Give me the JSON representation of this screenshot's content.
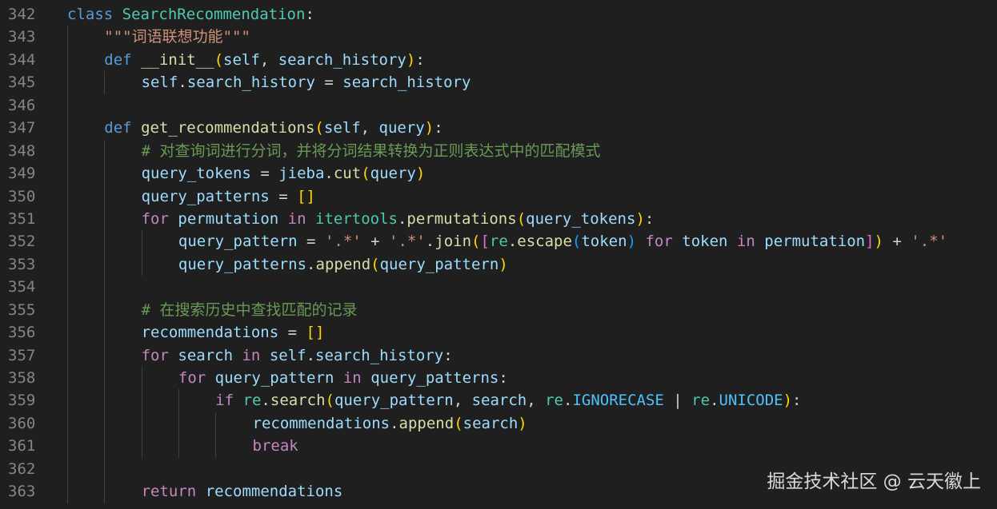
{
  "editor": {
    "lines": [
      {
        "n": "342",
        "indent": 0,
        "tokens": [
          [
            "kw",
            "class"
          ],
          [
            "op",
            " "
          ],
          [
            "cls",
            "SearchRecommendation"
          ],
          [
            "op",
            ":"
          ]
        ]
      },
      {
        "n": "343",
        "indent": 1,
        "tokens": [
          [
            "str",
            "\"\"\"词语联想功能\"\"\""
          ]
        ]
      },
      {
        "n": "344",
        "indent": 1,
        "tokens": [
          [
            "kw",
            "def"
          ],
          [
            "op",
            " "
          ],
          [
            "fn",
            "__init__"
          ],
          [
            "b1",
            "("
          ],
          [
            "var",
            "self"
          ],
          [
            "op",
            ", "
          ],
          [
            "var",
            "search_history"
          ],
          [
            "b1",
            ")"
          ],
          [
            "op",
            ":"
          ]
        ]
      },
      {
        "n": "345",
        "indent": 2,
        "tokens": [
          [
            "var",
            "self"
          ],
          [
            "op",
            "."
          ],
          [
            "var",
            "search_history"
          ],
          [
            "op",
            " = "
          ],
          [
            "var",
            "search_history"
          ]
        ]
      },
      {
        "n": "346",
        "indent": 0,
        "tokens": []
      },
      {
        "n": "347",
        "indent": 1,
        "tokens": [
          [
            "kw",
            "def"
          ],
          [
            "op",
            " "
          ],
          [
            "fn",
            "get_recommendations"
          ],
          [
            "b1",
            "("
          ],
          [
            "var",
            "self"
          ],
          [
            "op",
            ", "
          ],
          [
            "var",
            "query"
          ],
          [
            "b1",
            ")"
          ],
          [
            "op",
            ":"
          ]
        ]
      },
      {
        "n": "348",
        "indent": 2,
        "tokens": [
          [
            "com",
            "# 对查询词进行分词，并将分词结果转换为正则表达式中的匹配模式"
          ]
        ]
      },
      {
        "n": "349",
        "indent": 2,
        "tokens": [
          [
            "var",
            "query_tokens"
          ],
          [
            "op",
            " = "
          ],
          [
            "var",
            "jieba"
          ],
          [
            "op",
            "."
          ],
          [
            "fn",
            "cut"
          ],
          [
            "b1",
            "("
          ],
          [
            "var",
            "query"
          ],
          [
            "b1",
            ")"
          ]
        ]
      },
      {
        "n": "350",
        "indent": 2,
        "tokens": [
          [
            "var",
            "query_patterns"
          ],
          [
            "op",
            " = "
          ],
          [
            "b1",
            "[]"
          ]
        ]
      },
      {
        "n": "351",
        "indent": 2,
        "tokens": [
          [
            "ctl",
            "for"
          ],
          [
            "op",
            " "
          ],
          [
            "var",
            "permutation"
          ],
          [
            "op",
            " "
          ],
          [
            "ctl",
            "in"
          ],
          [
            "op",
            " "
          ],
          [
            "cls",
            "itertools"
          ],
          [
            "op",
            "."
          ],
          [
            "fn",
            "permutations"
          ],
          [
            "b1",
            "("
          ],
          [
            "var",
            "query_tokens"
          ],
          [
            "b1",
            ")"
          ],
          [
            "op",
            ":"
          ]
        ]
      },
      {
        "n": "352",
        "indent": 3,
        "tokens": [
          [
            "var",
            "query_pattern"
          ],
          [
            "op",
            " = "
          ],
          [
            "str",
            "'.*'"
          ],
          [
            "op",
            " + "
          ],
          [
            "str",
            "'.*'"
          ],
          [
            "op",
            "."
          ],
          [
            "fn",
            "join"
          ],
          [
            "b1",
            "("
          ],
          [
            "b2",
            "["
          ],
          [
            "cls",
            "re"
          ],
          [
            "op",
            "."
          ],
          [
            "fn",
            "escape"
          ],
          [
            "b3",
            "("
          ],
          [
            "var",
            "token"
          ],
          [
            "b3",
            ")"
          ],
          [
            "op",
            " "
          ],
          [
            "ctl",
            "for"
          ],
          [
            "op",
            " "
          ],
          [
            "var",
            "token"
          ],
          [
            "op",
            " "
          ],
          [
            "ctl",
            "in"
          ],
          [
            "op",
            " "
          ],
          [
            "var",
            "permutation"
          ],
          [
            "b2",
            "]"
          ],
          [
            "b1",
            ")"
          ],
          [
            "op",
            " + "
          ],
          [
            "str",
            "'.*'"
          ]
        ]
      },
      {
        "n": "353",
        "indent": 3,
        "tokens": [
          [
            "var",
            "query_patterns"
          ],
          [
            "op",
            "."
          ],
          [
            "fn",
            "append"
          ],
          [
            "b1",
            "("
          ],
          [
            "var",
            "query_pattern"
          ],
          [
            "b1",
            ")"
          ]
        ]
      },
      {
        "n": "354",
        "indent": 0,
        "tokens": []
      },
      {
        "n": "355",
        "indent": 2,
        "tokens": [
          [
            "com",
            "# 在搜索历史中查找匹配的记录"
          ]
        ]
      },
      {
        "n": "356",
        "indent": 2,
        "tokens": [
          [
            "var",
            "recommendations"
          ],
          [
            "op",
            " = "
          ],
          [
            "b1",
            "[]"
          ]
        ]
      },
      {
        "n": "357",
        "indent": 2,
        "tokens": [
          [
            "ctl",
            "for"
          ],
          [
            "op",
            " "
          ],
          [
            "var",
            "search"
          ],
          [
            "op",
            " "
          ],
          [
            "ctl",
            "in"
          ],
          [
            "op",
            " "
          ],
          [
            "var",
            "self"
          ],
          [
            "op",
            "."
          ],
          [
            "var",
            "search_history"
          ],
          [
            "op",
            ":"
          ]
        ]
      },
      {
        "n": "358",
        "indent": 3,
        "tokens": [
          [
            "ctl",
            "for"
          ],
          [
            "op",
            " "
          ],
          [
            "var",
            "query_pattern"
          ],
          [
            "op",
            " "
          ],
          [
            "ctl",
            "in"
          ],
          [
            "op",
            " "
          ],
          [
            "var",
            "query_patterns"
          ],
          [
            "op",
            ":"
          ]
        ]
      },
      {
        "n": "359",
        "indent": 4,
        "tokens": [
          [
            "ctl",
            "if"
          ],
          [
            "op",
            " "
          ],
          [
            "cls",
            "re"
          ],
          [
            "op",
            "."
          ],
          [
            "fn",
            "search"
          ],
          [
            "b1",
            "("
          ],
          [
            "var",
            "query_pattern"
          ],
          [
            "op",
            ", "
          ],
          [
            "var",
            "search"
          ],
          [
            "op",
            ", "
          ],
          [
            "cls",
            "re"
          ],
          [
            "op",
            "."
          ],
          [
            "cst",
            "IGNORECASE"
          ],
          [
            "op",
            " | "
          ],
          [
            "cls",
            "re"
          ],
          [
            "op",
            "."
          ],
          [
            "cst",
            "UNICODE"
          ],
          [
            "b1",
            ")"
          ],
          [
            "op",
            ":"
          ]
        ]
      },
      {
        "n": "360",
        "indent": 5,
        "tokens": [
          [
            "var",
            "recommendations"
          ],
          [
            "op",
            "."
          ],
          [
            "fn",
            "append"
          ],
          [
            "b1",
            "("
          ],
          [
            "var",
            "search"
          ],
          [
            "b1",
            ")"
          ]
        ]
      },
      {
        "n": "361",
        "indent": 5,
        "tokens": [
          [
            "ctl",
            "break"
          ]
        ]
      },
      {
        "n": "362",
        "indent": 0,
        "tokens": []
      },
      {
        "n": "363",
        "indent": 2,
        "tokens": [
          [
            "ctl",
            "return"
          ],
          [
            "op",
            " "
          ],
          [
            "var",
            "recommendations"
          ]
        ]
      }
    ],
    "guides": {
      "343": 1,
      "344": 1,
      "345": 2,
      "346": 1,
      "347": 1,
      "348": 2,
      "349": 2,
      "350": 2,
      "351": 2,
      "352": 3,
      "353": 3,
      "354": 2,
      "355": 2,
      "356": 2,
      "357": 2,
      "358": 3,
      "359": 4,
      "360": 5,
      "361": 5,
      "362": 2,
      "363": 2
    }
  },
  "watermark": "掘金技术社区 @ 云天徽上"
}
